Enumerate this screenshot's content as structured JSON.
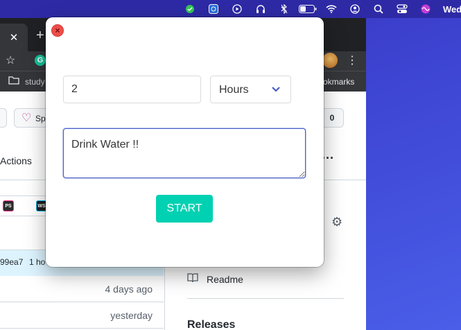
{
  "menubar": {
    "icons": [
      "green-dot-icon",
      "screen-capture-icon",
      "play-icon",
      "headphones-icon",
      "bluetooth-icon",
      "battery-icon",
      "wifi-icon",
      "user-icon",
      "search-icon",
      "control-center-icon",
      "siri-icon"
    ],
    "clock": "Wed"
  },
  "browser": {
    "tab_close": "✕",
    "new_tab": "+",
    "bookmark_left": "study",
    "bookmark_right": "okmarks",
    "page": {
      "sponsor_label": "Sp",
      "count": "0",
      "actions_tab": "Actions",
      "commit_hash": "99ea7",
      "commit_time": "1 ho",
      "file_times": [
        "4 days ago",
        "yesterday"
      ],
      "readme": "Readme",
      "releases": "Releases"
    }
  },
  "modal": {
    "duration_value": "2",
    "unit_selected": "Hours",
    "message_value": "Drink Water !!",
    "start_label": "START",
    "colors": {
      "primary": "#00d1b2",
      "focus": "#485fc7",
      "close": "#ed4f4a"
    }
  }
}
